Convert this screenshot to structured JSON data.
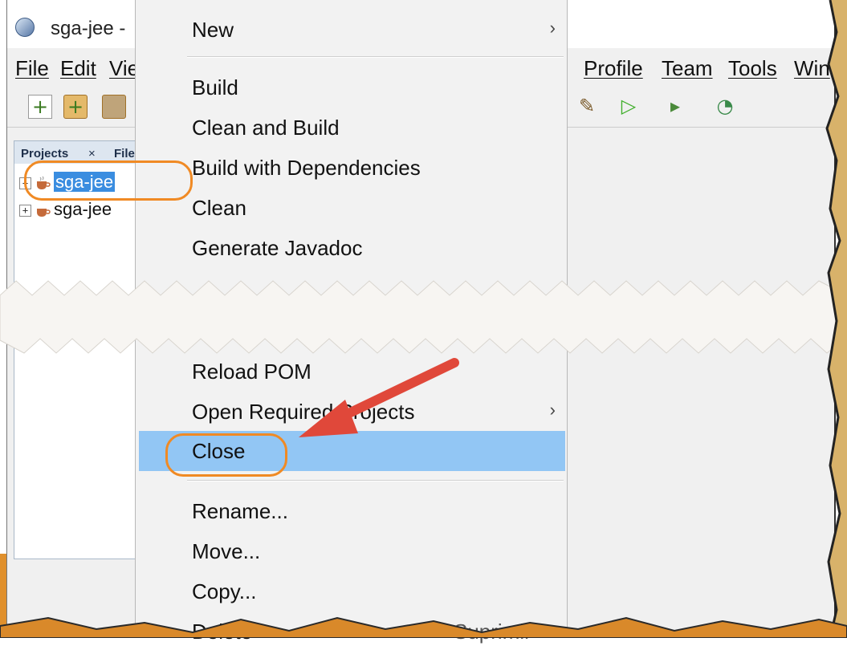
{
  "window": {
    "title": "sga-jee -"
  },
  "menubar": {
    "left_items": [
      "File",
      "Edit",
      "Vie"
    ],
    "right_items": [
      "Profile",
      "Team",
      "Tools",
      "Win"
    ]
  },
  "toolbar": {
    "icons": [
      "new-file-icon",
      "new-project-icon",
      "open-project-icon",
      "clean-build-icon",
      "run-icon",
      "debug-icon",
      "profile-icon"
    ]
  },
  "projects_panel": {
    "tabs": [
      "Projects",
      "File"
    ],
    "tab_close": "×",
    "tree": [
      {
        "label": "sga-jee",
        "selected": true
      },
      {
        "label": "sga-jee",
        "selected": false
      }
    ]
  },
  "context_menu": {
    "items_top": [
      {
        "label": "New",
        "submenu": true
      },
      {
        "label": "Build",
        "submenu": false
      },
      {
        "label": "Clean and Build",
        "submenu": false
      },
      {
        "label": "Build with Dependencies",
        "submenu": false
      },
      {
        "label": "Clean",
        "submenu": false
      },
      {
        "label": "Generate Javadoc",
        "submenu": false
      }
    ],
    "items_bottom": [
      {
        "label": "Reload POM",
        "submenu": false
      },
      {
        "label": "Open Required Projects",
        "submenu": true
      },
      {
        "label": "Close",
        "submenu": false,
        "highlighted": true
      },
      {
        "label": "Rename...",
        "submenu": false
      },
      {
        "label": "Move...",
        "submenu": false
      },
      {
        "label": "Copy...",
        "submenu": false
      },
      {
        "label": "Delete",
        "submenu": false
      },
      {
        "label": "Suprimir",
        "submenu": false
      }
    ],
    "submenu_arrow": "›"
  },
  "colors": {
    "highlight": "#92c6f4",
    "selection": "#3a8de0",
    "annotation": "#f08a24",
    "arrow": "#e0483a",
    "background_band": "#e0902c"
  }
}
